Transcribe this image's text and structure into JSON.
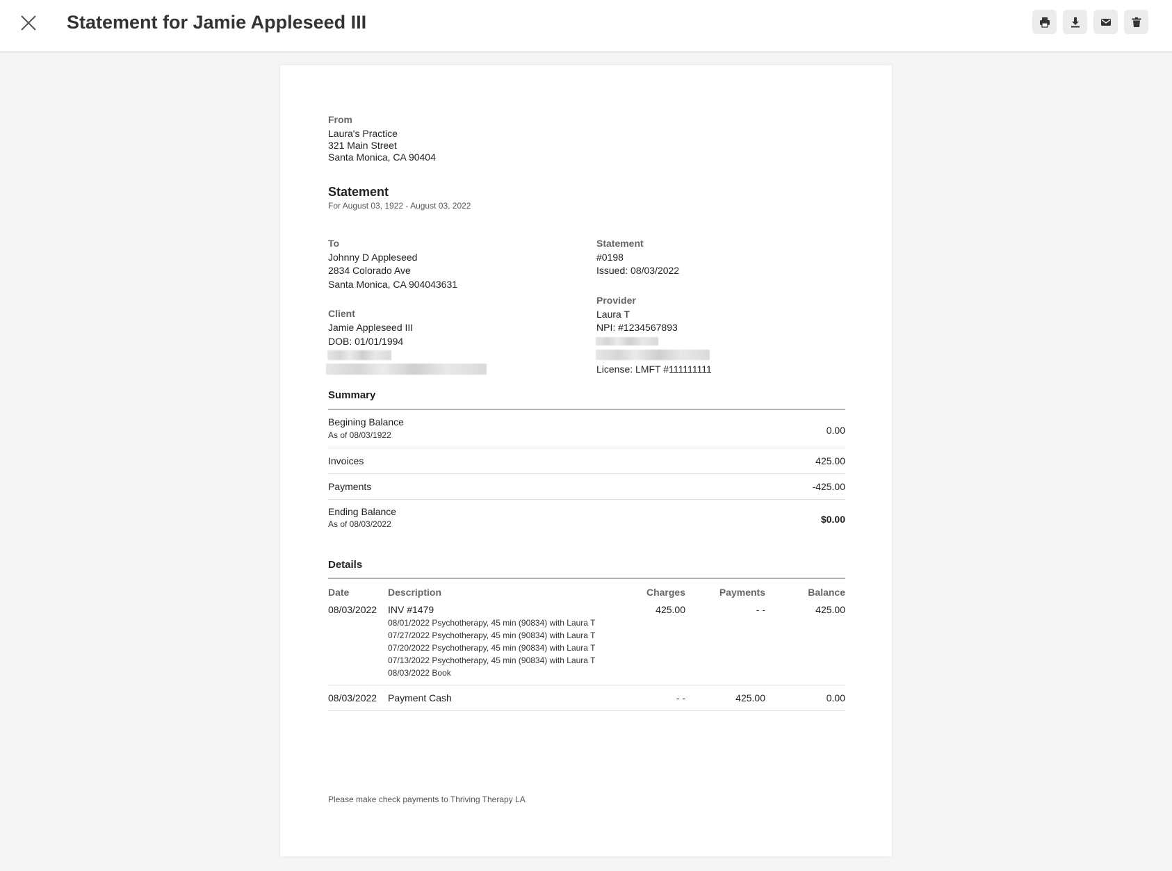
{
  "header": {
    "title": "Statement for Jamie Appleseed III",
    "icons": [
      "close-icon",
      "print-icon",
      "download-icon",
      "email-icon",
      "trash-icon"
    ]
  },
  "from": {
    "label": "From",
    "name": "Laura's Practice",
    "street": "321 Main Street",
    "city": "Santa Monica, CA 90404"
  },
  "statement_heading": {
    "title": "Statement",
    "period": "For August 03, 1922 - August 03, 2022"
  },
  "to": {
    "label": "To",
    "name": "Johnny D Appleseed",
    "street": "2834 Colorado Ave",
    "city": "Santa Monica, CA 904043631"
  },
  "statement_info": {
    "label": "Statement",
    "number": "#0198",
    "issued": "Issued: 08/03/2022"
  },
  "client": {
    "label": "Client",
    "name": "Jamie Appleseed III",
    "dob": "DOB: 01/01/1994"
  },
  "provider": {
    "label": "Provider",
    "name": "Laura T",
    "npi": "NPI: #1234567893",
    "license": "License: LMFT #111111111"
  },
  "summary": {
    "title": "Summary",
    "beginning_label": "Begining Balance",
    "beginning_sub": "As of 08/03/1922",
    "beginning_value": "0.00",
    "invoices_label": "Invoices",
    "invoices_value": "425.00",
    "payments_label": "Payments",
    "payments_value": "-425.00",
    "ending_label": "Ending Balance",
    "ending_sub": "As of 08/03/2022",
    "ending_value": "$0.00"
  },
  "details": {
    "title": "Details",
    "columns": {
      "date": "Date",
      "description": "Description",
      "charges": "Charges",
      "payments": "Payments",
      "balance": "Balance"
    },
    "rows": [
      {
        "date": "08/03/2022",
        "description": "INV #1479",
        "lines": [
          "08/01/2022 Psychotherapy, 45 min (90834) with Laura T",
          "07/27/2022 Psychotherapy, 45 min (90834) with Laura T",
          "07/20/2022 Psychotherapy, 45 min (90834) with Laura T",
          "07/13/2022 Psychotherapy, 45 min (90834) with Laura T",
          "08/03/2022 Book"
        ],
        "charges": "425.00",
        "payments": "- -",
        "balance": "425.00"
      },
      {
        "date": "08/03/2022",
        "description": "Payment Cash",
        "charges": "- -",
        "payments": "425.00",
        "balance": "0.00"
      }
    ]
  },
  "footer_note": "Please make check payments to Thriving Therapy LA"
}
